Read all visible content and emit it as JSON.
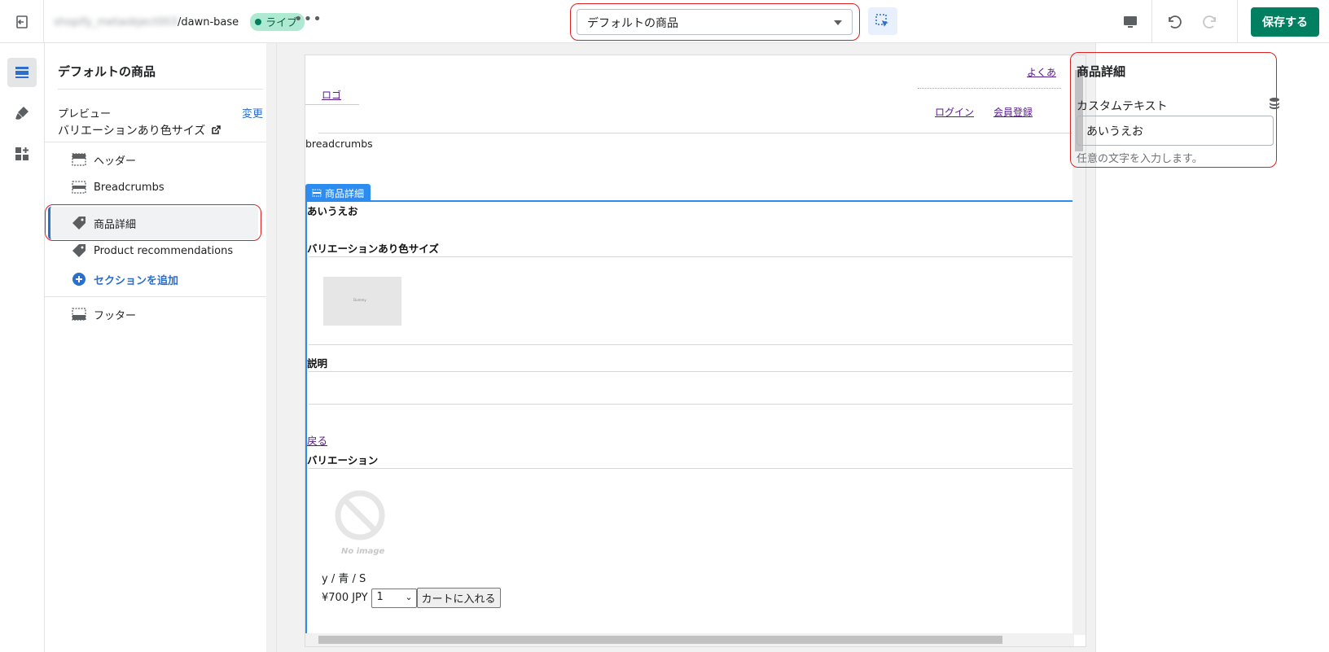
{
  "topbar": {
    "store_blurred": "shopify_metaobject003",
    "store_path": "/dawn-base",
    "status_badge": "ライブ",
    "more_label": "•••",
    "template_select": "デフォルトの商品",
    "save_label": "保存する"
  },
  "sidebar": {
    "title": "デフォルトの商品",
    "preview_label": "プレビュー",
    "preview_change": "変更",
    "preview_value": "バリエーションあり色サイズ",
    "sections": [
      {
        "label": "ヘッダー",
        "icon": "header-section-icon"
      },
      {
        "label": "Breadcrumbs",
        "icon": "dashed-section-icon"
      },
      {
        "label": "商品詳細",
        "icon": "tag-icon",
        "selected": true
      },
      {
        "label": "Product recommendations",
        "icon": "tag-icon"
      },
      {
        "label": "セクションを追加",
        "icon": "plus-circle-icon"
      },
      {
        "label": "フッター",
        "icon": "footer-section-icon"
      }
    ]
  },
  "preview": {
    "top_link": "よくあ",
    "logo_link": "ロゴ",
    "login_link": "ログイン",
    "register_link": "会員登録",
    "breadcrumbs": "breadcrumbs",
    "section_tab": "商品詳細",
    "custom_text": "あいうえお",
    "product_title": "バリエーションあり色サイズ",
    "image_small_text": "Dummy",
    "description_heading": "説明",
    "back_link": "戻る",
    "variation_heading": "バリエーション",
    "no_image_text": "No image",
    "variant_name": "y / 青 / S",
    "price": "¥700 JPY",
    "qty_value": "1",
    "cart_button": "カートに入れる"
  },
  "settings": {
    "title": "商品詳細",
    "field_label": "カスタムテキスト",
    "field_value": "あいうえお",
    "field_help": "任意の文字を入力します。"
  },
  "colors": {
    "accent": "#2c6ecb",
    "save_green": "#008060",
    "highlight_red": "#e02020",
    "section_blue": "#2c8cf0"
  }
}
